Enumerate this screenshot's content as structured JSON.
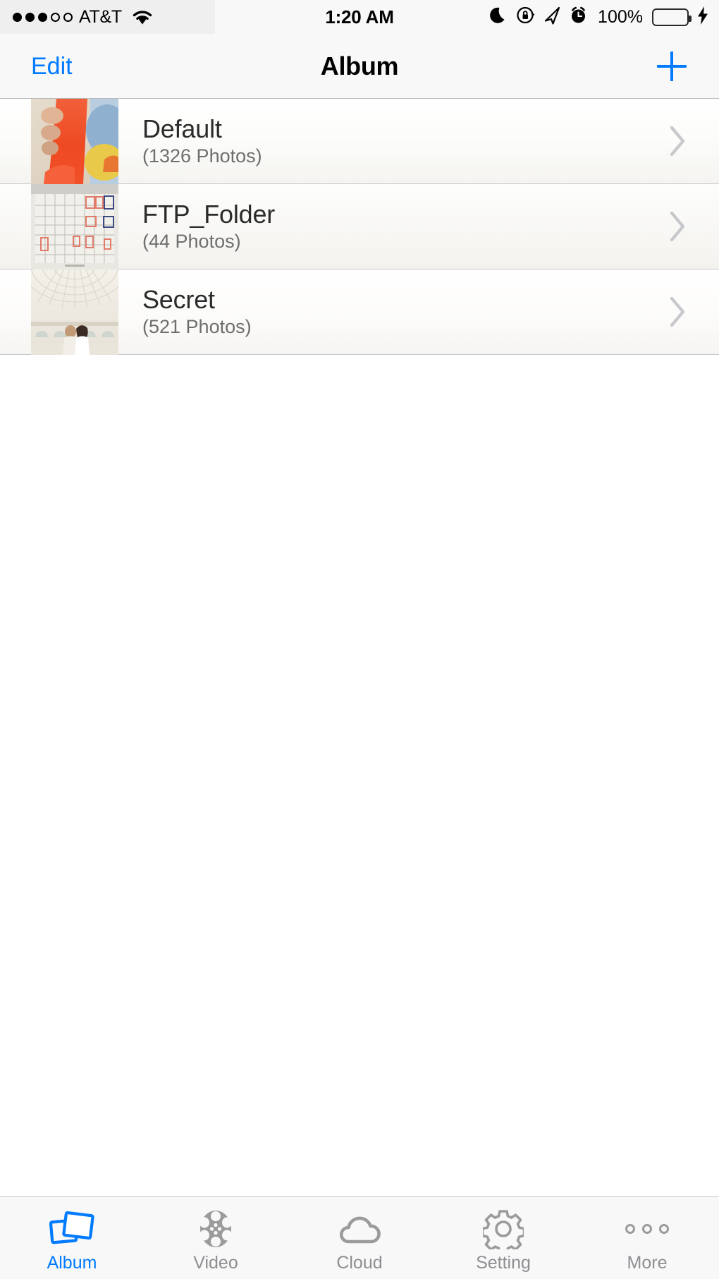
{
  "status_bar": {
    "signal_dots_filled": 3,
    "signal_dots_total": 5,
    "carrier": "AT&T",
    "wifi_icon": "wifi-icon",
    "time": "1:20 AM",
    "do_not_disturb_icon": "moon-icon",
    "rotation_lock_icon": "rotation-lock-icon",
    "location_icon": "location-arrow-icon",
    "alarm_icon": "alarm-clock-icon",
    "battery_percent": "100%",
    "battery_icon": "battery-full-icon",
    "charging_icon": "lightning-bolt-icon",
    "battery_color": "#4cd964"
  },
  "nav_bar": {
    "left_button": "Edit",
    "title": "Album",
    "right_button_icon": "plus-icon",
    "tint_color": "#007aff"
  },
  "albums": [
    {
      "name": "Default",
      "count_label": "(1326 Photos)",
      "thumbnail": "orange-fabric-photo",
      "chevron_icon": "chevron-right-icon"
    },
    {
      "name": "FTP_Folder",
      "count_label": "(44 Photos)",
      "thumbnail": "document-table-photo",
      "chevron_icon": "chevron-right-icon"
    },
    {
      "name": "Secret",
      "count_label": "(521 Photos)",
      "thumbnail": "wedding-dome-photo",
      "chevron_icon": "chevron-right-icon"
    }
  ],
  "tab_bar": {
    "active_color": "#007aff",
    "inactive_color": "#8e8e93",
    "items": [
      {
        "label": "Album",
        "icon": "photos-stack-icon",
        "active": true
      },
      {
        "label": "Video",
        "icon": "film-reel-icon",
        "active": false
      },
      {
        "label": "Cloud",
        "icon": "cloud-icon",
        "active": false
      },
      {
        "label": "Setting",
        "icon": "gear-icon",
        "active": false
      },
      {
        "label": "More",
        "icon": "three-dots-icon",
        "active": false
      }
    ]
  }
}
